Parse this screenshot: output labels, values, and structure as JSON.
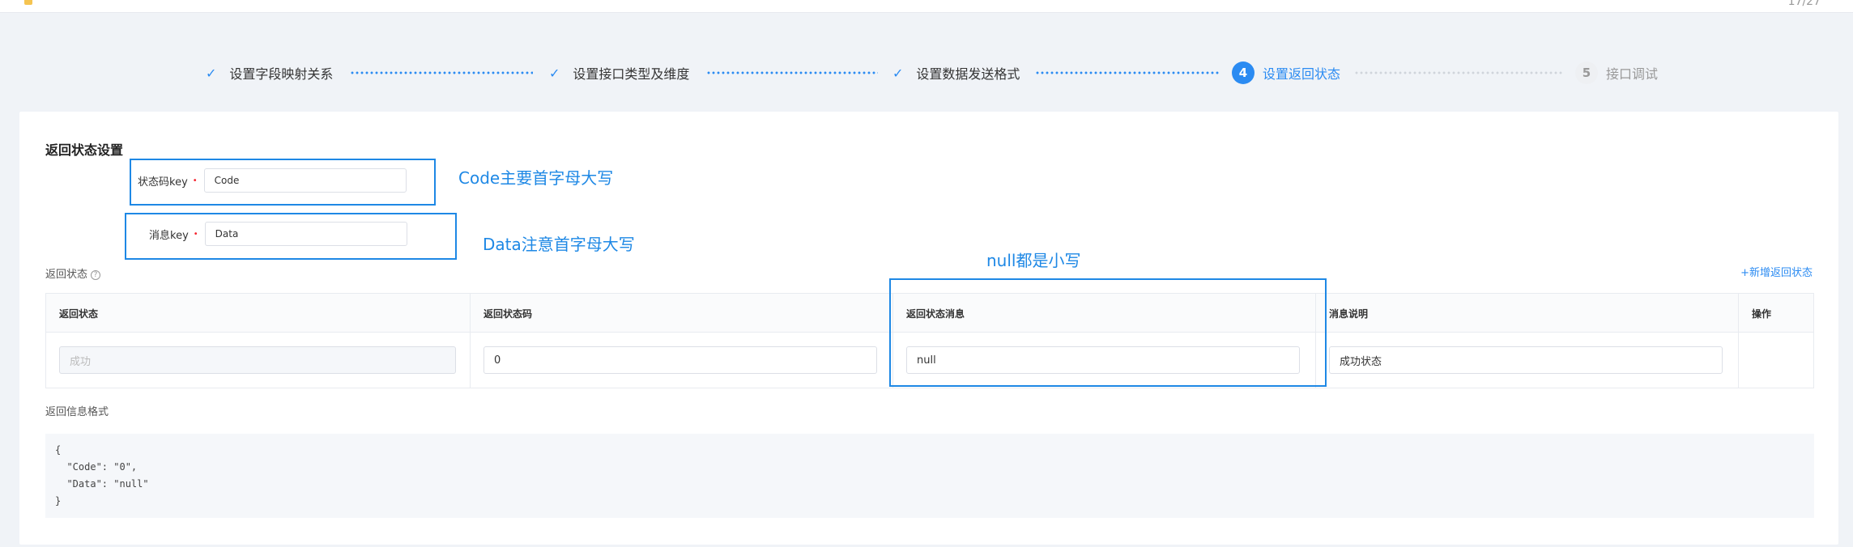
{
  "topbar": {
    "page_indicator": "17/27"
  },
  "steps": [
    {
      "label": "设置字段映射关系",
      "state": "done",
      "number": "1"
    },
    {
      "label": "设置接口类型及维度",
      "state": "done",
      "number": "2"
    },
    {
      "label": "设置数据发送格式",
      "state": "done",
      "number": "3"
    },
    {
      "label": "设置返回状态",
      "state": "active",
      "number": "4"
    },
    {
      "label": "接口调试",
      "state": "todo",
      "number": "5"
    }
  ],
  "check_glyph": "✓",
  "section": {
    "title": "返回状态设置",
    "status_code_key": {
      "label": "状态码key",
      "value": "Code"
    },
    "message_key": {
      "label": "消息key",
      "value": "Data"
    },
    "required_mark": "•"
  },
  "annotations": {
    "code_note": "Code主要首字母大写",
    "data_note": "Data注意首字母大写",
    "null_note": "null都是小写"
  },
  "return_status": {
    "label": "返回状态",
    "help_icon": "?",
    "add_link": "+新增返回状态",
    "columns": [
      "返回状态",
      "返回状态码",
      "返回状态消息",
      "消息说明",
      "操作"
    ],
    "rows": [
      {
        "status": "成功",
        "code": "0",
        "message": "null",
        "description": "成功状态"
      }
    ]
  },
  "format": {
    "label": "返回信息格式",
    "code": "{\n  \"Code\": \"0\",\n  \"Data\": \"null\"\n}"
  },
  "colors": {
    "accent": "#2b8bf2",
    "annotation": "#1e88e5",
    "required": "#f5222d"
  }
}
